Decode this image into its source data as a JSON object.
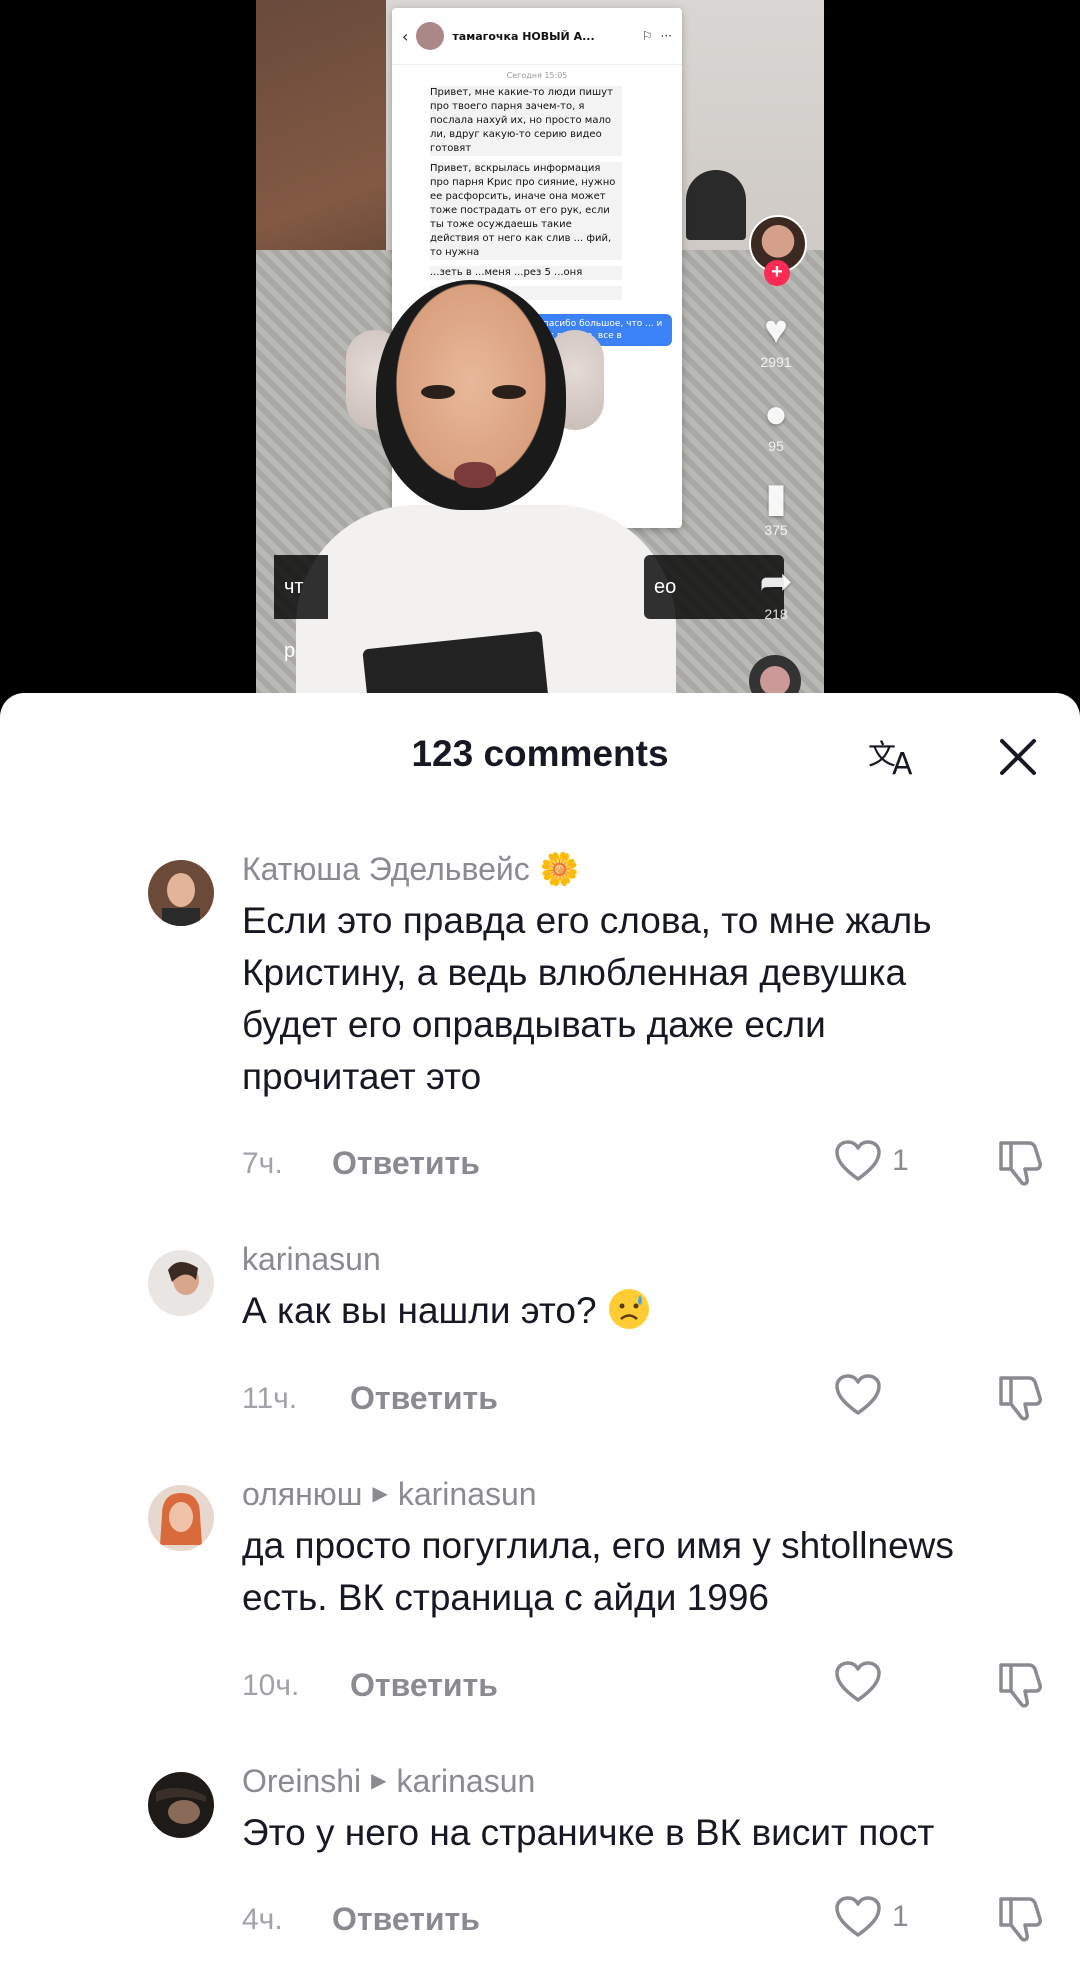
{
  "video": {
    "chat_screenshot": {
      "contact": "тамагочка НОВЫЙ А...",
      "time": "Сегодня 15:05",
      "messages": [
        "Привет, мне какие-то люди пишут про твоего парня зачем-то, я послала нахуй их, но просто мало ли, вдруг какую-то серию видео готовят",
        "Привет, вскрылась информация про парня Крис про сияние, нужно ее расфорсить, иначе она может тоже пострадать от его рук, если ты тоже осуждаешь такие действия от него как слив ... фий, то нужна",
        "...зеть в ...меня ...рез 5 ...оня",
        "...адан 5"
      ],
      "outgoing": "спасибо большое, что ... и так в курсе, все в"
    },
    "caption_left": "чт р",
    "caption_right": "ео",
    "rail": {
      "likes": "2991",
      "comments": "95",
      "saves": "375",
      "shares": "218"
    }
  },
  "sheet": {
    "title": "123 comments",
    "translate_icon": "translate-icon",
    "close_icon": "close-icon"
  },
  "comments": [
    {
      "user": "Катюша Эдельвейс",
      "user_suffix": "🌼",
      "text_lines": [
        "Если это правда его слова, то мне жаль",
        "Кристину, а ведь влюбленная девушка",
        "будет его оправдывать даже если",
        "прочитает это"
      ],
      "time": "7ч.",
      "reply": "Ответить",
      "likes": "1"
    },
    {
      "user": "karinasun",
      "text_lines": [
        "А как вы нашли это?"
      ],
      "time": "11ч.",
      "reply": "Ответить",
      "likes": ""
    },
    {
      "user": "олянюш",
      "reply_to": "karinasun",
      "text_lines": [
        "да просто погуглила, его имя у shtollnews",
        "есть. ВК страница с айди 1996"
      ],
      "time": "10ч.",
      "reply": "Ответить",
      "likes": ""
    },
    {
      "user": "Oreinshi",
      "reply_to": "karinasun",
      "text_lines": [
        "Это у него на страничке в ВК висит пост"
      ],
      "time": "4ч.",
      "reply": "Ответить",
      "likes": "1"
    }
  ]
}
